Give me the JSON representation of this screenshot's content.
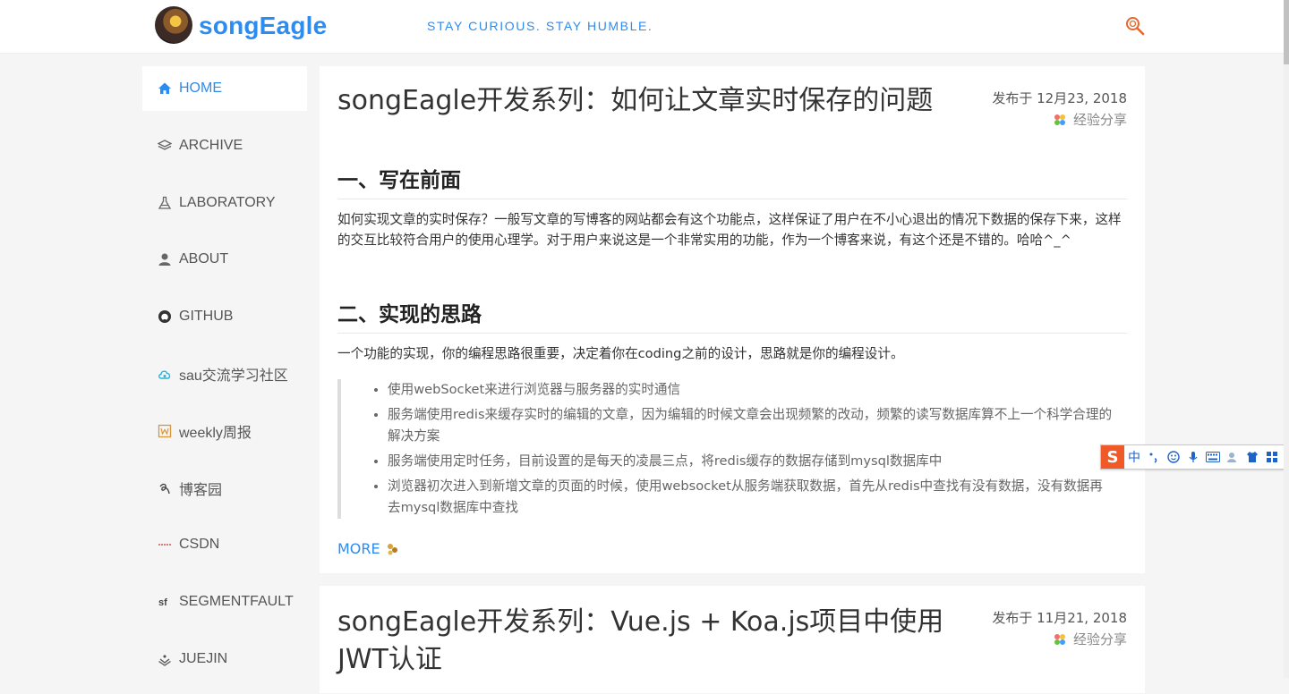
{
  "header": {
    "brand": "songEagle",
    "motto": "STAY CURIOUS. STAY HUMBLE."
  },
  "sidebar": {
    "items": [
      {
        "label": "HOME",
        "icon": "home-icon"
      },
      {
        "label": "ARCHIVE",
        "icon": "layers-icon"
      },
      {
        "label": "LABORATORY",
        "icon": "flask-icon"
      },
      {
        "label": "ABOUT",
        "icon": "user-icon"
      },
      {
        "label": "GITHUB",
        "icon": "github-icon"
      },
      {
        "label": "sau交流学习社区",
        "icon": "cloud-icon"
      },
      {
        "label": "weekly周报",
        "icon": "weekly-icon"
      },
      {
        "label": "博客园",
        "icon": "cnblogs-icon"
      },
      {
        "label": "CSDN",
        "icon": "csdn-icon"
      },
      {
        "label": "SEGMENTFAULT",
        "icon": "segmentfault-icon"
      },
      {
        "label": "JUEJIN",
        "icon": "juejin-icon"
      }
    ]
  },
  "posts": [
    {
      "title": "songEagle开发系列：如何让文章实时保存的问题",
      "date": "发布于 12月23, 2018",
      "category": "经验分享",
      "section1_heading": "一、写在前面",
      "section1_text": "如何实现文章的实时保存？一般写文章的写博客的网站都会有这个功能点，这样保证了用户在不小心退出的情况下数据的保存下来，这样的交互比较符合用户的使用心理学。对于用户来说这是一个非常实用的功能，作为一个博客来说，有这个还是不错的。哈哈^_^",
      "section2_heading": "二、实现的思路",
      "section2_text": "一个功能的实现，你的编程思路很重要，决定着你在coding之前的设计，思路就是你的编程设计。",
      "bullets": [
        "使用webSocket来进行浏览器与服务器的实时通信",
        "服务端使用redis来缓存实时的编辑的文章，因为编辑的时候文章会出现频繁的改动，频繁的读写数据库算不上一个科学合理的解决方案",
        "服务端使用定时任务，目前设置的是每天的凌晨三点，将redis缓存的数据存储到mysql数据库中",
        "浏览器初次进入到新增文章的页面的时候，使用websocket从服务端获取数据，首先从redis中查找有没有数据，没有数据再去mysql数据库中查找"
      ],
      "more": "MORE"
    },
    {
      "title": "songEagle开发系列：Vue.js + Koa.js项目中使用JWT认证",
      "date": "发布于 11月21, 2018",
      "category": "经验分享"
    }
  ],
  "ime": {
    "logo": "S",
    "mode": "中"
  },
  "colors": {
    "accent": "#2d8cf0",
    "background": "#f5f5f5",
    "ime_orange": "#ef5a28"
  }
}
